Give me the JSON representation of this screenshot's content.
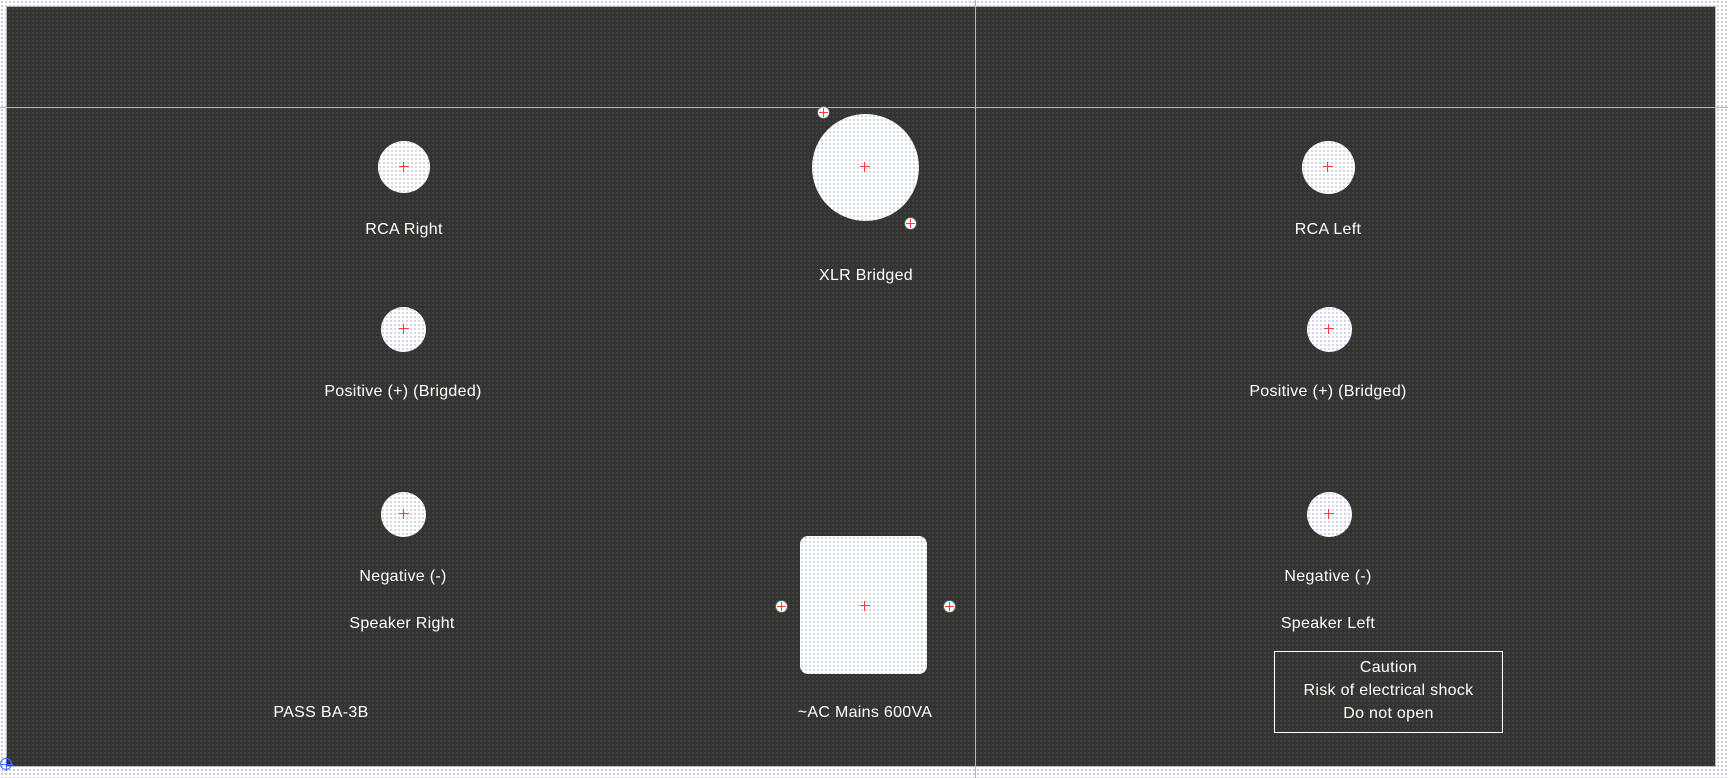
{
  "panel": {
    "title_label": "PASS BA-3B",
    "labels": {
      "rca_right": "RCA Right",
      "xlr_bridged": "XLR Bridged",
      "rca_left": "RCA Left",
      "positive_right": "Positive (+) (Brigded)",
      "positive_left": "Positive (+) (Bridged)",
      "negative_right": "Negative (-)",
      "negative_left": "Negative (-)",
      "speaker_right": "Speaker Right",
      "speaker_left": "Speaker Left",
      "ac_mains": "~AC Mains 600VA"
    },
    "caution": {
      "line1": "Caution",
      "line2": "Risk of electrical shock",
      "line3": "Do not open"
    }
  },
  "colors": {
    "panel_bg": "#34342f",
    "hole_fill": "#ffffff",
    "center_mark": "#ff3b3b",
    "text": "#ffffff",
    "guide": "#b8b8b8"
  },
  "icons": {
    "center_mark": "crosshair-icon",
    "screw": "screw-icon",
    "origin": "origin-marker-icon"
  }
}
